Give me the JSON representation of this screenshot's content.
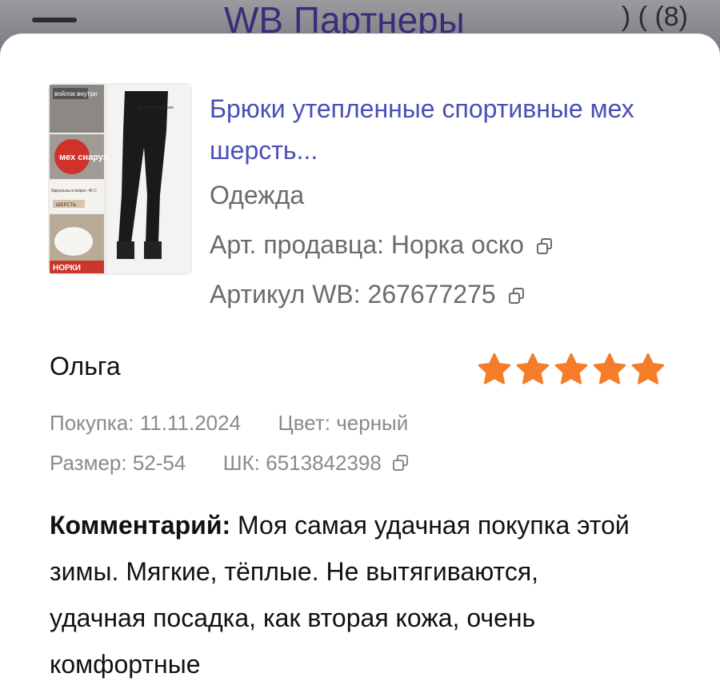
{
  "topbar": {
    "title": "WB Партнеры",
    "icons_text": ") ( (8)"
  },
  "product": {
    "title": "Брюки утепленные спортивные мех шерсть...",
    "category": "Одежда",
    "seller_article_label": "Арт. продавца:",
    "seller_article_value": "Норка оско",
    "wb_article_label": "Артикул WB:",
    "wb_article_value": "267677275",
    "thumbnail_labels": [
      "войлок внутри",
      "двойное утепление",
      "мех снаружи",
      "Идеальны в мороз -40 С",
      "ШЕРСТЬ",
      "НОРКИ"
    ]
  },
  "review": {
    "author": "Ольга",
    "rating": 5,
    "rating_max": 5,
    "purchase_label": "Покупка:",
    "purchase_date": "11.11.2024",
    "color_label": "Цвет:",
    "color_value": "черный",
    "size_label": "Размер:",
    "size_value": "52-54",
    "barcode_label": "ШК:",
    "barcode_value": "6513842398",
    "comment_label": "Комментарий:",
    "comment_text": "Моя самая удачная покупка этой зимы. Мягкие, тёплые. Не вытягиваются, удачная посадка, как вторая кожа, очень комфортные"
  },
  "icons": {
    "copy": "copy-icon",
    "star": "star-icon",
    "menu": "menu-icon"
  },
  "colors": {
    "link": "#4a4fb5",
    "star": "#f57c28",
    "muted": "#8a8a8a"
  }
}
